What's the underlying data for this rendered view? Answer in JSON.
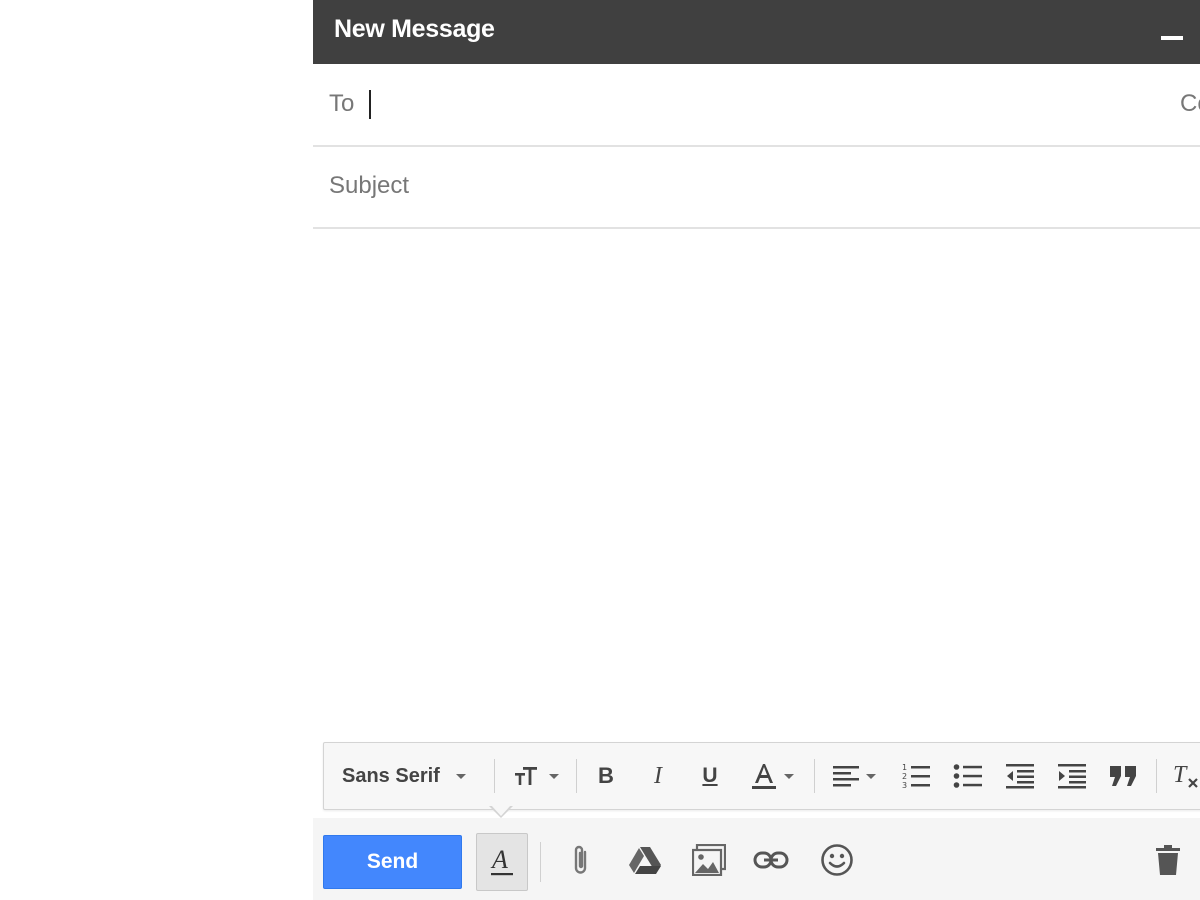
{
  "compose": {
    "title": "New Message",
    "to_label": "To",
    "cc_label": "Cc",
    "subject_placeholder": "Subject",
    "subject_value": "",
    "body_value": ""
  },
  "format_toolbar": {
    "font_family": "Sans Serif",
    "icons": [
      "font-size-icon",
      "bold-icon",
      "italic-icon",
      "underline-icon",
      "text-color-icon",
      "align-icon",
      "numbered-list-icon",
      "bulleted-list-icon",
      "indent-less-icon",
      "indent-more-icon",
      "quote-icon",
      "remove-formatting-icon"
    ]
  },
  "bottom_bar": {
    "send_label": "Send",
    "icons": [
      "formatting-options-icon",
      "attach-file-icon",
      "google-drive-icon",
      "insert-photo-icon",
      "insert-link-icon",
      "emoji-icon",
      "trash-icon"
    ]
  },
  "colors": {
    "titlebar": "#404040",
    "send_button": "#4387fd",
    "label_gray": "#777777"
  }
}
